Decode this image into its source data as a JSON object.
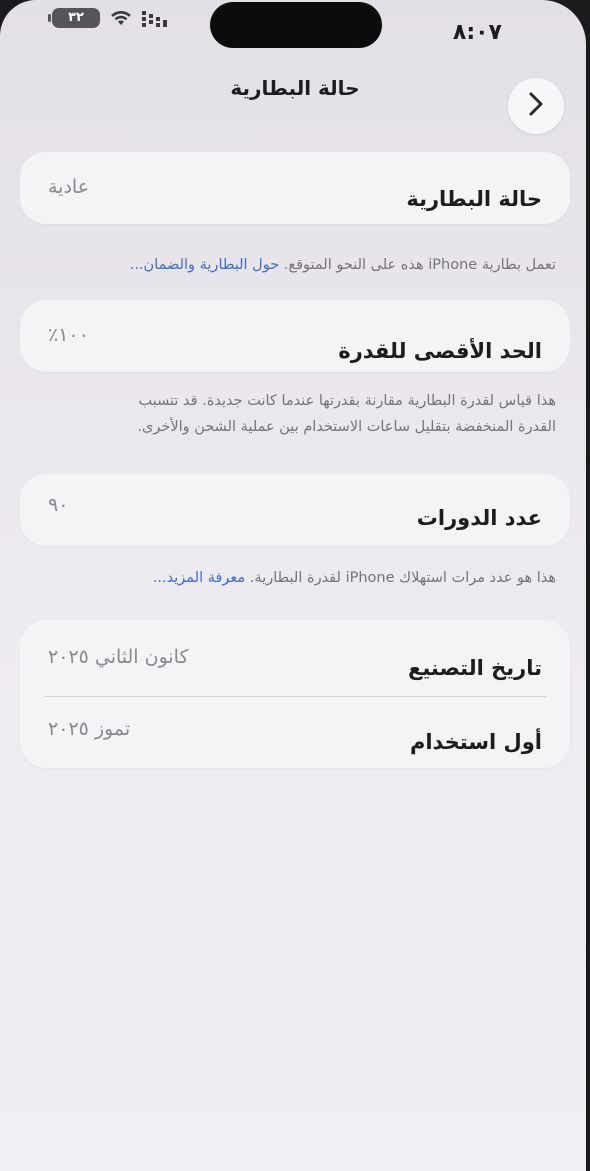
{
  "status_bar": {
    "time": "٨:٠٧",
    "battery_level": "٣٢",
    "wifi": "wifi-icon",
    "signal": "signal-icon"
  },
  "nav": {
    "title": "حالة البطارية",
    "back_icon": "chevron-right-icon"
  },
  "battery_health": {
    "label": "حالة البطارية",
    "value": "عادية",
    "footnote_text": "تعمل بطارية iPhone هذه على النحو المتوقع. ",
    "footnote_link": "حول البطارية والضمان..."
  },
  "maximum_capacity": {
    "label": "الحد الأقصى للقدرة",
    "value": "٪١٠٠",
    "footnote_line1": "هذا قياس لقدرة البطارية مقارنة بقدرتها عندما كانت جديدة. قد تتسبب",
    "footnote_line2": "القدرة المنخفضة بتقليل ساعات الاستخدام بين عملية الشحن والأخرى."
  },
  "cycle_count": {
    "label": "عدد الدورات",
    "value": "٩٠",
    "footnote_text": "هذا هو عدد مرات استهلاك iPhone لقدرة البطارية. ",
    "footnote_link": "معرفة المزيد..."
  },
  "dates": {
    "manufacture_label": "تاريخ التصنيع",
    "manufacture_value": "كانون الثاني ٢٠٢٥",
    "first_use_label": "أول استخدام",
    "first_use_value": "تموز ٢٠٢٥"
  },
  "colors": {
    "link": "#3b6fc9",
    "background": "#e9e6ec",
    "card": "#f4f3f6"
  }
}
